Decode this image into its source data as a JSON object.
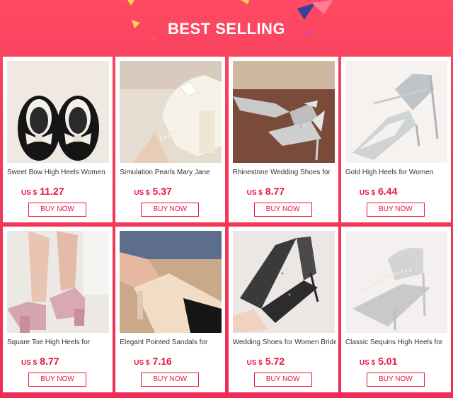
{
  "banner": {
    "title": "BEST SELLING"
  },
  "colors": {
    "accent": "#e8143a",
    "background": "#f43c5c"
  },
  "products": [
    {
      "title": "Sweet Bow High Heels Women",
      "currency": "US $",
      "price": "11.27",
      "buy_label": "BUY NOW",
      "image": "black-bow-loafer-image"
    },
    {
      "title": "Simulation Pearls Mary Jane",
      "currency": "US $",
      "price": "5.37",
      "buy_label": "BUY NOW",
      "image": "white-pearl-mary-jane-image"
    },
    {
      "title": "Rhinestone Wedding Shoes for",
      "currency": "US $",
      "price": "8.77",
      "buy_label": "BUY NOW",
      "image": "silver-rhinestone-bow-pump-image"
    },
    {
      "title": "Gold High Heels for Women",
      "currency": "US $",
      "price": "6.44",
      "buy_label": "BUY NOW",
      "image": "silver-pointed-heel-image"
    },
    {
      "title": "Square Toe High Heels for",
      "currency": "US $",
      "price": "8.77",
      "buy_label": "BUY NOW",
      "image": "pink-block-heel-image"
    },
    {
      "title": "Elegant Pointed Sandals for",
      "currency": "US $",
      "price": "7.16",
      "buy_label": "BUY NOW",
      "image": "beige-black-slingback-image"
    },
    {
      "title": "Wedding Shoes for Women Bride",
      "currency": "US $",
      "price": "5.72",
      "buy_label": "BUY NOW",
      "image": "glitter-black-stiletto-image"
    },
    {
      "title": "Classic Sequins High Heels for",
      "currency": "US $",
      "price": "5.01",
      "buy_label": "BUY NOW",
      "image": "silver-sequin-pearl-heel-image"
    }
  ]
}
